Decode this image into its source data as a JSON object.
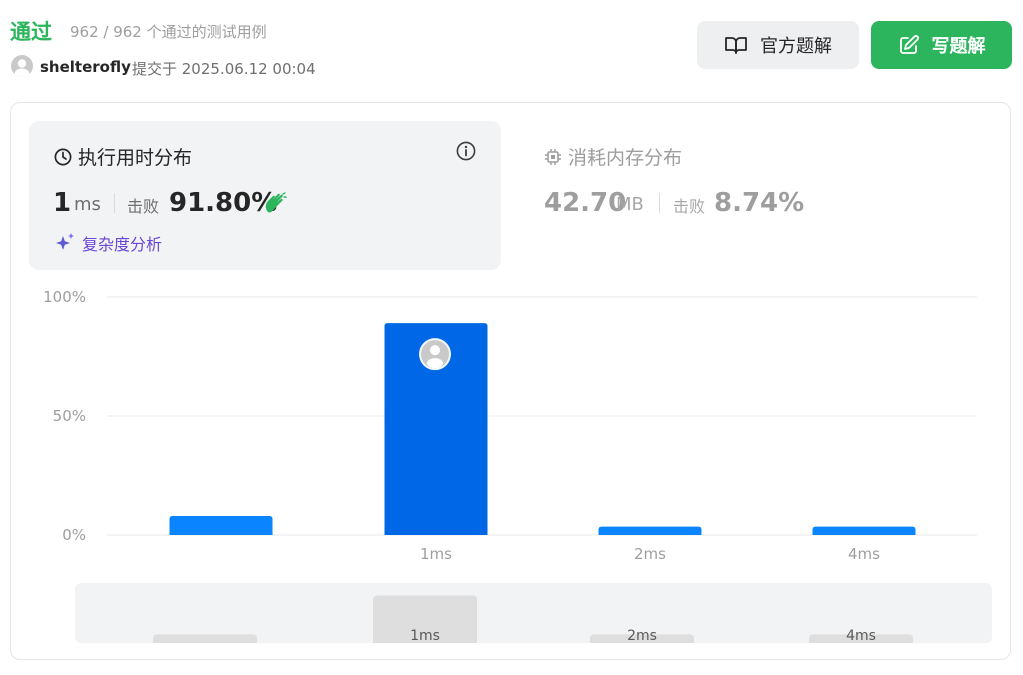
{
  "header": {
    "status": "通过",
    "cases": "962 / 962 个通过的测试用例",
    "author": "shelterofly",
    "submitted": "提交于 2025.06.12 00:04",
    "official_solution_label": "官方题解",
    "write_solution_label": "写题解"
  },
  "runtime": {
    "title": "执行用时分布",
    "value": "1",
    "unit": "ms",
    "beat_label": "击败",
    "beat_value": "91.80%",
    "complexity_label": "复杂度分析"
  },
  "memory": {
    "title": "消耗内存分布",
    "value": "42.70",
    "unit": "MB",
    "beat_label": "击败",
    "beat_value": "8.74%"
  },
  "colors": {
    "accent_green": "#2db55d",
    "bar_blue": "#0a84ff",
    "bar_active": "#0068e6",
    "mini_bar": "#dedede",
    "complexity_purple": "#6a45d6"
  },
  "icons": {
    "official": "book-open-icon",
    "write": "edit-icon",
    "clock": "clock-icon",
    "info": "info-icon",
    "chip": "chip-icon",
    "sparkle": "sparkle-icon",
    "clap": "clap-icon"
  },
  "chart_data": {
    "type": "bar",
    "categories": [
      "",
      "1ms",
      "2ms",
      "4ms"
    ],
    "values": [
      8,
      89,
      3.5,
      3.5
    ],
    "highlight_index": 1,
    "ylim": [
      0,
      100
    ],
    "y_ticks": [
      "100%",
      "50%",
      "0%"
    ],
    "grid": true,
    "mini_values": [
      4,
      22,
      4,
      4
    ]
  }
}
